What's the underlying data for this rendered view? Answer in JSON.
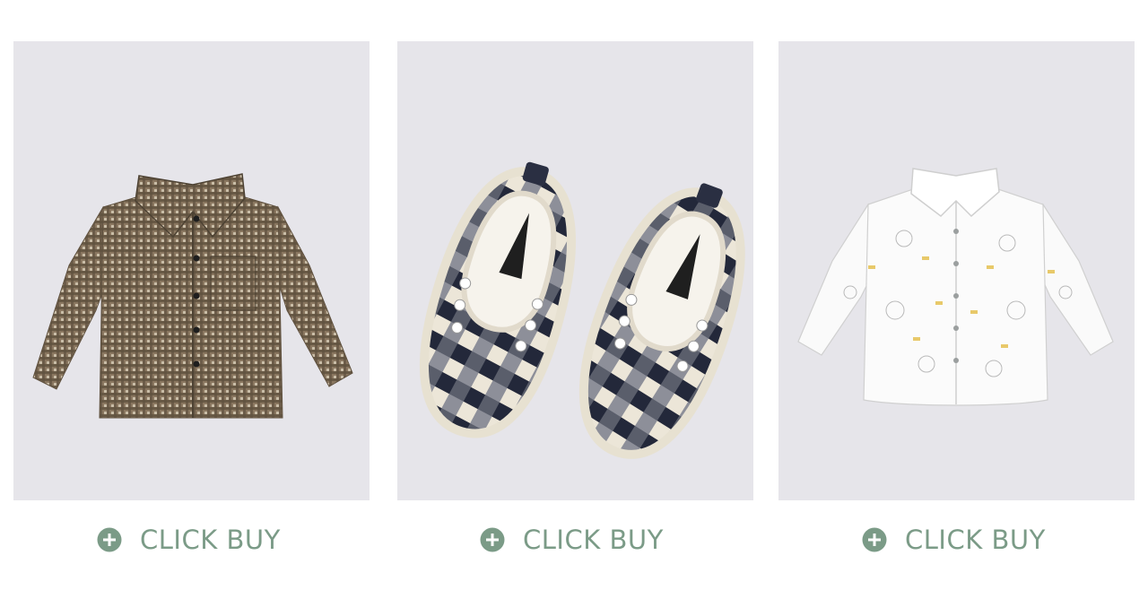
{
  "products": [
    {
      "name": "plaid-shirt",
      "image_icon": "brown-plaid-shirt-icon",
      "buy_label": "CLICK BUY"
    },
    {
      "name": "plaid-shoes",
      "image_icon": "plaid-slip-on-shoes-icon",
      "buy_label": "CLICK BUY"
    },
    {
      "name": "print-shirt",
      "image_icon": "white-print-shirt-icon",
      "buy_label": "CLICK BUY"
    }
  ],
  "colors": {
    "card_bg": "#e6e5ea",
    "accent": "#7b9b87"
  }
}
